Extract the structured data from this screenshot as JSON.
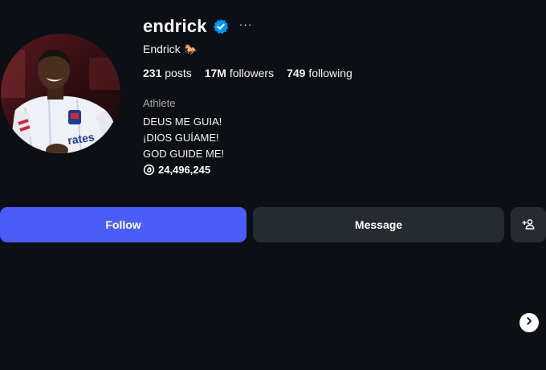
{
  "profile": {
    "username": "endrick",
    "more_label": "···",
    "full_name": "Endrick",
    "full_name_emoji_icon": "horse-icon",
    "stats": {
      "posts_count": "231",
      "posts_label": " posts",
      "followers_count": "17M",
      "followers_label": " followers",
      "following_count": "749",
      "following_label": " following"
    },
    "category": "Athlete",
    "bio_lines": [
      "DEUS ME GUIA!",
      "¡DIOS GUÍAME!",
      "GOD GUIDE ME!"
    ],
    "threads_count": "24,496,245"
  },
  "actions": {
    "follow_label": "Follow",
    "message_label": "Message",
    "suggest_icon": "add-person-icon"
  },
  "navigation": {
    "next_icon": "chevron-right-icon"
  },
  "colors": {
    "background": "#0c0f14",
    "accent": "#4a5df9",
    "verified": "#0095f6",
    "secondary_button": "#262a31",
    "muted_text": "#a8a8a8"
  }
}
